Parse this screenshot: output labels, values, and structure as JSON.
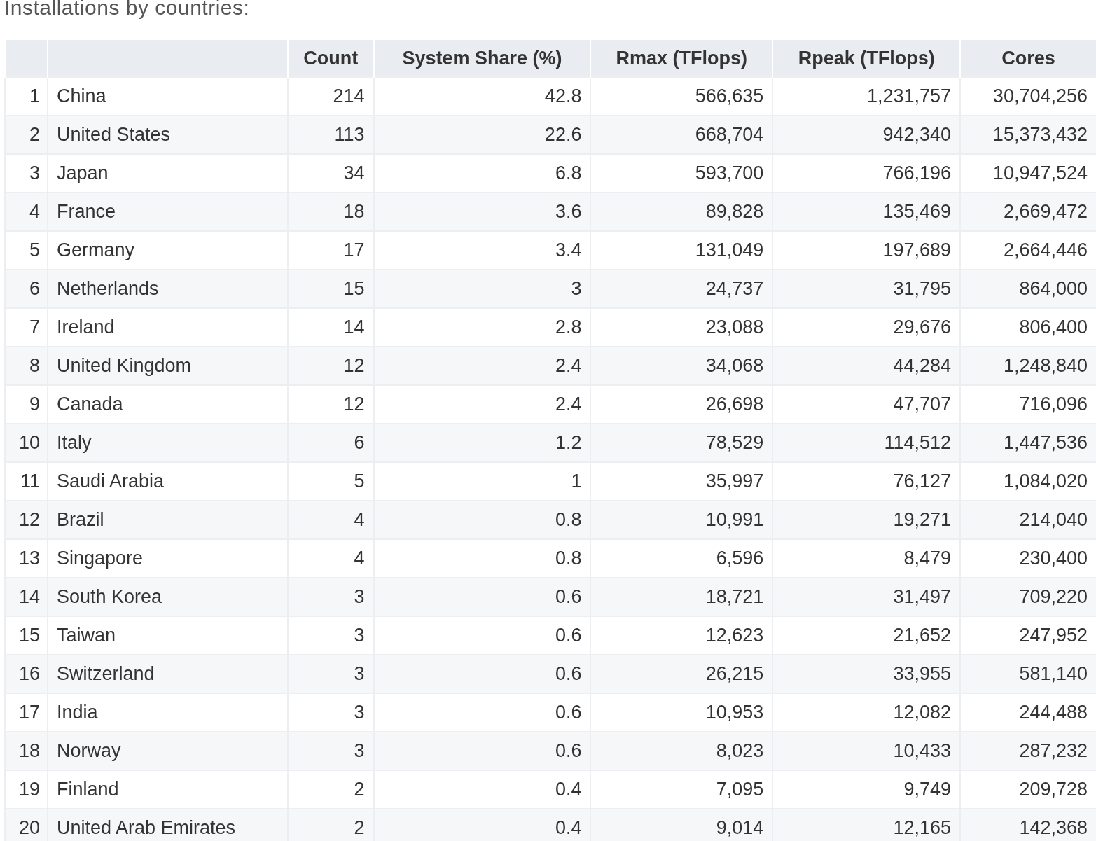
{
  "title": "Installations by countries:",
  "table": {
    "columns": [
      "",
      "",
      "Count",
      "System Share (%)",
      "Rmax (TFlops)",
      "Rpeak (TFlops)",
      "Cores"
    ],
    "rows": [
      [
        "1",
        "China",
        "214",
        "42.8",
        "566,635",
        "1,231,757",
        "30,704,256"
      ],
      [
        "2",
        "United States",
        "113",
        "22.6",
        "668,704",
        "942,340",
        "15,373,432"
      ],
      [
        "3",
        "Japan",
        "34",
        "6.8",
        "593,700",
        "766,196",
        "10,947,524"
      ],
      [
        "4",
        "France",
        "18",
        "3.6",
        "89,828",
        "135,469",
        "2,669,472"
      ],
      [
        "5",
        "Germany",
        "17",
        "3.4",
        "131,049",
        "197,689",
        "2,664,446"
      ],
      [
        "6",
        "Netherlands",
        "15",
        "3",
        "24,737",
        "31,795",
        "864,000"
      ],
      [
        "7",
        "Ireland",
        "14",
        "2.8",
        "23,088",
        "29,676",
        "806,400"
      ],
      [
        "8",
        "United Kingdom",
        "12",
        "2.4",
        "34,068",
        "44,284",
        "1,248,840"
      ],
      [
        "9",
        "Canada",
        "12",
        "2.4",
        "26,698",
        "47,707",
        "716,096"
      ],
      [
        "10",
        "Italy",
        "6",
        "1.2",
        "78,529",
        "114,512",
        "1,447,536"
      ],
      [
        "11",
        "Saudi Arabia",
        "5",
        "1",
        "35,997",
        "76,127",
        "1,084,020"
      ],
      [
        "12",
        "Brazil",
        "4",
        "0.8",
        "10,991",
        "19,271",
        "214,040"
      ],
      [
        "13",
        "Singapore",
        "4",
        "0.8",
        "6,596",
        "8,479",
        "230,400"
      ],
      [
        "14",
        "South Korea",
        "3",
        "0.6",
        "18,721",
        "31,497",
        "709,220"
      ],
      [
        "15",
        "Taiwan",
        "3",
        "0.6",
        "12,623",
        "21,652",
        "247,952"
      ],
      [
        "16",
        "Switzerland",
        "3",
        "0.6",
        "26,215",
        "33,955",
        "581,140"
      ],
      [
        "17",
        "India",
        "3",
        "0.6",
        "10,953",
        "12,082",
        "244,488"
      ],
      [
        "18",
        "Norway",
        "3",
        "0.6",
        "8,023",
        "10,433",
        "287,232"
      ],
      [
        "19",
        "Finland",
        "2",
        "0.4",
        "7,095",
        "9,749",
        "209,728"
      ],
      [
        "20",
        "United Arab Emirates",
        "2",
        "0.4",
        "9,014",
        "12,165",
        "142,368"
      ]
    ]
  }
}
